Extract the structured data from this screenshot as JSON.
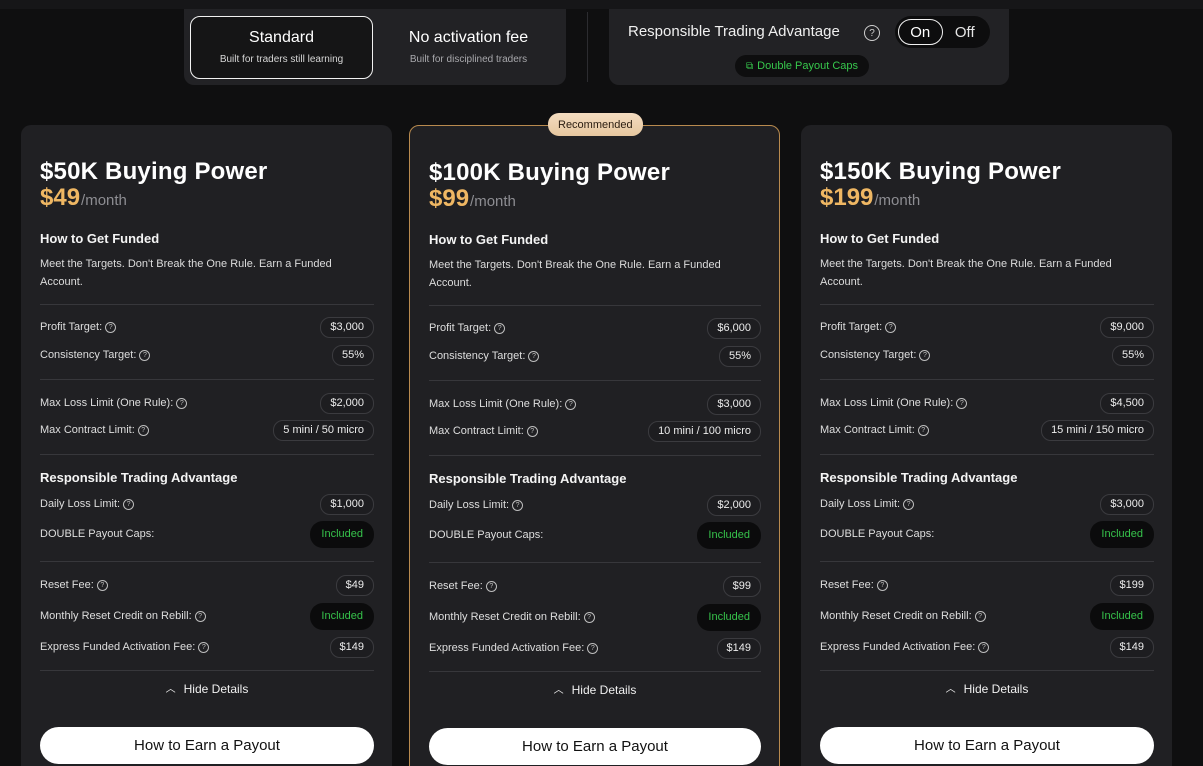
{
  "plan_toggle": {
    "options": [
      {
        "title": "Standard",
        "subtitle": "Built for traders still learning"
      },
      {
        "title": "No activation fee",
        "subtitle": "Built for disciplined traders"
      }
    ]
  },
  "rta": {
    "title": "Responsible Trading Advantage",
    "help_glyph": "?",
    "on_label": "On",
    "off_label": "Off",
    "badge": "Double Payout Caps"
  },
  "common": {
    "how_heading": "How to Get Funded",
    "description": "Meet the Targets. Don't Break the One Rule. Earn a Funded Account.",
    "per_month": "/month",
    "rta_heading": "Responsible Trading Advantage",
    "labels": {
      "profit_target": "Profit Target:",
      "consistency_target": "Consistency Target:",
      "max_loss": "Max Loss Limit (One Rule):",
      "max_contract": "Max Contract Limit:",
      "daily_loss": "Daily Loss Limit:",
      "double_caps": "DOUBLE Payout Caps:",
      "reset_fee": "Reset Fee:",
      "reset_credit": "Monthly Reset Credit on Rebill:",
      "activation_fee": "Express Funded Activation Fee:"
    },
    "included": "Included",
    "hide_details": "Hide Details",
    "cta": "How to Earn a Payout",
    "recommended": "Recommended",
    "q": "?"
  },
  "cards": [
    {
      "title": "$50K Buying Power",
      "price": "$49",
      "profit_target": "$3,000",
      "consistency_target": "55%",
      "max_loss": "$2,000",
      "max_contract": "5 mini / 50 micro",
      "daily_loss": "$1,000",
      "reset_fee": "$49",
      "activation_fee": "$149"
    },
    {
      "title": "$100K Buying Power",
      "price": "$99",
      "profit_target": "$6,000",
      "consistency_target": "55%",
      "max_loss": "$3,000",
      "max_contract": "10 mini / 100 micro",
      "daily_loss": "$2,000",
      "reset_fee": "$99",
      "activation_fee": "$149"
    },
    {
      "title": "$150K Buying Power",
      "price": "$199",
      "profit_target": "$9,000",
      "consistency_target": "55%",
      "max_loss": "$4,500",
      "max_contract": "15 mini / 150 micro",
      "daily_loss": "$3,000",
      "reset_fee": "$199",
      "activation_fee": "$149"
    }
  ]
}
